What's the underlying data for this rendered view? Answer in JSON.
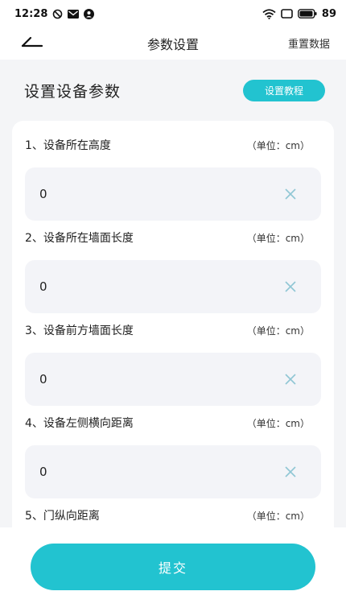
{
  "status_bar": {
    "time": "12:28",
    "battery": "89",
    "left_icons": [
      "alarm-off-icon",
      "mail-icon",
      "account-icon"
    ],
    "right_icons": [
      "wifi-icon",
      "screen-icon",
      "battery-icon"
    ]
  },
  "nav": {
    "title": "参数设置",
    "reset_label": "重置数据"
  },
  "section": {
    "title": "设置设备参数",
    "tutorial_label": "设置教程"
  },
  "params": [
    {
      "label": "1、设备所在高度",
      "unit": "（单位：cm）",
      "value": "0"
    },
    {
      "label": "2、设备所在墙面长度",
      "unit": "（单位：cm）",
      "value": "0"
    },
    {
      "label": "3、设备前方墙面长度",
      "unit": "（单位：cm）",
      "value": "0"
    },
    {
      "label": "4、设备左侧横向距离",
      "unit": "（单位：cm）",
      "value": "0"
    },
    {
      "label": "5、门纵向距离",
      "unit": "（单位：cm）",
      "value": ""
    }
  ],
  "footer": {
    "submit_label": "提交"
  },
  "colors": {
    "accent": "#22c3d0",
    "input_bg": "#f3f4f8",
    "page_bg": "#f4f5f7"
  }
}
